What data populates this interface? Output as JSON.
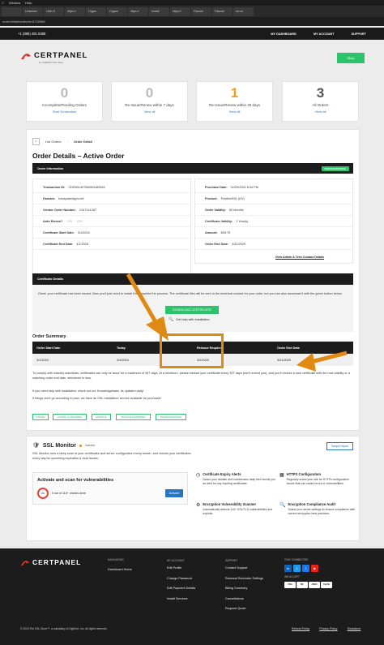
{
  "browser": {
    "menu": [
      "",
      "Window",
      "Help"
    ],
    "tabs": [
      "",
      "Unsubscr",
      "Utah S",
      "https://",
      "Organ",
      "Organi",
      "https://",
      "Install",
      "https://",
      "Fascah",
      "Fascah",
      "ssl ce"
    ],
    "url": "order/detail/order/id=6732665"
  },
  "header": {
    "phone": "+1 (888) 481.5388",
    "nav": [
      "MY DASHBOARD",
      "MY ACCOUNT",
      "SUPPORT"
    ]
  },
  "brand": {
    "name": "CERTPANEL",
    "sub": "by COMODO SSL Store",
    "shop": "Shop",
    "accent": "#2bc36b"
  },
  "stats": [
    {
      "num": "0",
      "label": "Incomplete/Pending Orders",
      "link": "Start Generation"
    },
    {
      "num": "0",
      "label": "Re-Issue/Renew within 7 days",
      "link": "View all"
    },
    {
      "num": "1",
      "label": "Re-Issue/Renew within 30 days",
      "link": "View all"
    },
    {
      "num": "3",
      "label": "All Orders",
      "link": "View all"
    }
  ],
  "breadcrumb": {
    "home": "",
    "list": "List Orders",
    "current": "Order Detail"
  },
  "page_title": "Order Details – Active Order",
  "order_info": {
    "header": "Order Information",
    "badge": "REISSUE/INVOICE",
    "left": [
      {
        "k": "Transaction ID:",
        "v": "CDR831497583M3189345"
      },
      {
        "k": "Domain:",
        "v": "transparentgov.net"
      },
      {
        "k": "Vendor Order Number:",
        "v": "2147141267"
      },
      {
        "k": "Auto Renew?",
        "v": "ON",
        "v2": "OFF"
      },
      {
        "k": "Certificate Start Date:",
        "v": "3/1/2024"
      },
      {
        "k": "Certificate End Date:",
        "v": "4/1/2025"
      }
    ],
    "right": [
      {
        "k": "Purchase Date:",
        "v": "02/29/2024 6:34 PM"
      },
      {
        "k": "Product:",
        "v": "PositiveSSL (DV)"
      },
      {
        "k": "Order Validity:",
        "v": "60 Months"
      },
      {
        "k": "Certificate Validity:",
        "v": "1 Year(s)"
      },
      {
        "k": "Amount:",
        "v": "$39.75"
      },
      {
        "k": "Order End Date:",
        "v": "3/31/2029"
      }
    ],
    "contact_link": "View Admin & Tech Contact Details"
  },
  "cert_details": {
    "header": "Certificate Details",
    "text": "Great, your certificate has been issued. Now you'll just need to install it to complete the process. The certificate files will be sent to the technical contact for your order, but you can also download it with the green button below.",
    "download": "DOWNLOAD CERTIFICATE",
    "help": "Get help with Installation"
  },
  "summary": {
    "title": "Order Summary",
    "cols": [
      "Order Start Date",
      "Today",
      "Reissue Required",
      "Order End Date"
    ],
    "row": [
      "3/1/2024",
      "3/4/2024",
      "3/2/2025",
      "3/31/2029"
    ],
    "note1": "To comply with industry standards, certificates can only be issue for a maximum of 397 days. At a minimum, please reissue your certificate every 397 days (we'll remind you), and you'll receive a new certificate with the max validity or a matching order end date, whichever is less.",
    "note2": "If you need help with installation, check out our Knowledgebase, its updated daily!",
    "note3": "If things don't go according to plan, we have an SSL Installation service available for purchase!",
    "actions": [
      "CANCEL",
      "CANCEL & REORDER",
      "REISSUE",
      "MANAGE REMINDER",
      "REISSUE/INVOICE"
    ]
  },
  "monitor": {
    "title": "SSL Monitor",
    "status": "Inactive",
    "desc": "SSL Monitor runs a deep scan of your certificates and server configuration every month, and checks your certificates every day for upcoming expiration & trust issues.",
    "sample": "Sample Report",
    "activate_title": "Activate and scan for vulnerabilities",
    "checks": "0 out of 110+ checks done",
    "progress": "0%",
    "activate_btn": "Activate",
    "features": [
      {
        "t": "Certificate Expiry Alerts",
        "d": "Scans your domain and subdomains daily then sends you an alert for any expiring certificates."
      },
      {
        "t": "HTTPS Configuration",
        "d": "Regularly scans your site for HTTPs configuration issues that can cause errors or vulnerabilities."
      },
      {
        "t": "Encryption Vulnerability Scanner",
        "d": "Automatically detects 110+ SSL/TLS vulnerabilities and exploits."
      },
      {
        "t": "Encryption Compliance Audit",
        "d": "Scans your server settings to ensure compliance with current encryption best practices."
      }
    ]
  },
  "footer": {
    "brand": "CERTPANEL",
    "cols": [
      {
        "h": "NAVIGATION",
        "items": [
          "Dashboard Home"
        ]
      },
      {
        "h": "MY ACCOUNT",
        "items": [
          "Edit Profile",
          "Change Password",
          "Edit Payment Details",
          "Install Services"
        ]
      },
      {
        "h": "SUPPORT",
        "items": [
          "Contact Support",
          "Renewal Reminder Settings",
          "Billing Summary",
          "Cancellations",
          "Request Quote"
        ]
      }
    ],
    "stay": "STAY CONNECTED",
    "accept": "WE ACCEPT",
    "pay": [
      "VISA",
      "MC",
      "AMEX",
      "PayPal"
    ],
    "copyright": "© 2024 The SSL Store™, a subsidiary of DigiCert, Inc. All rights reserved.",
    "links": [
      "Refund Policy",
      "Privacy Policy",
      "Disclaimer"
    ]
  }
}
